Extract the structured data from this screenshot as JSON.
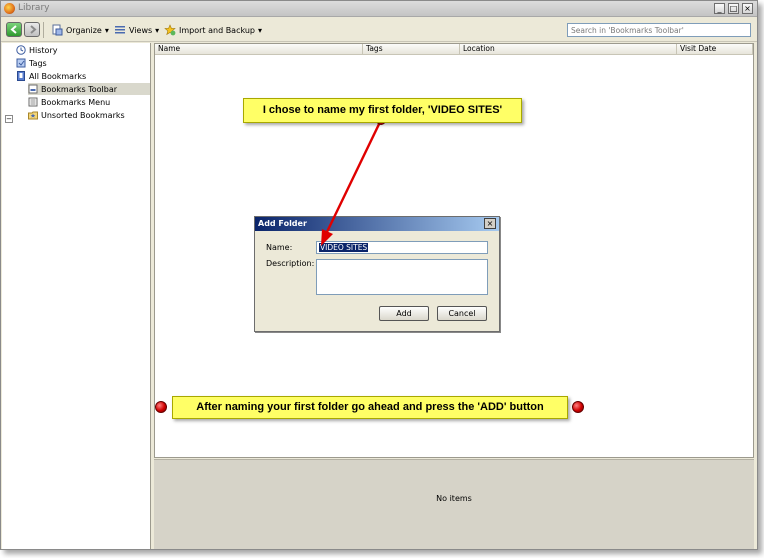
{
  "window": {
    "title": "Library"
  },
  "toolbar": {
    "organize_label": "Organize",
    "views_label": "Views",
    "import_label": "Import and Backup",
    "search_placeholder": "Search in 'Bookmarks Toolbar'"
  },
  "sidebar": {
    "items": [
      {
        "label": "History",
        "icon": "history-icon"
      },
      {
        "label": "Tags",
        "icon": "tags-icon"
      },
      {
        "label": "All Bookmarks",
        "icon": "bookmarks-icon"
      },
      {
        "label": "Bookmarks Toolbar",
        "icon": "toolbar-folder-icon",
        "selected": true
      },
      {
        "label": "Bookmarks Menu",
        "icon": "menu-folder-icon"
      },
      {
        "label": "Unsorted Bookmarks",
        "icon": "unsorted-folder-icon"
      }
    ]
  },
  "columns": [
    "Name",
    "Tags",
    "Location",
    "Visit Date"
  ],
  "details": {
    "empty_text": "No items"
  },
  "dialog": {
    "title": "Add Folder",
    "name_label": "Name:",
    "name_value": "VIDEO SITES",
    "description_label": "Description:",
    "add_label": "Add",
    "cancel_label": "Cancel"
  },
  "annotations": {
    "callout_top": "I chose to name my first folder, 'VIDEO SITES'",
    "callout_bottom": "After naming your first folder go ahead and press the 'ADD' button"
  },
  "colors": {
    "callout_bg": "#ffff66",
    "arrow": "#e00000",
    "dialog_title": "#0a246a"
  }
}
